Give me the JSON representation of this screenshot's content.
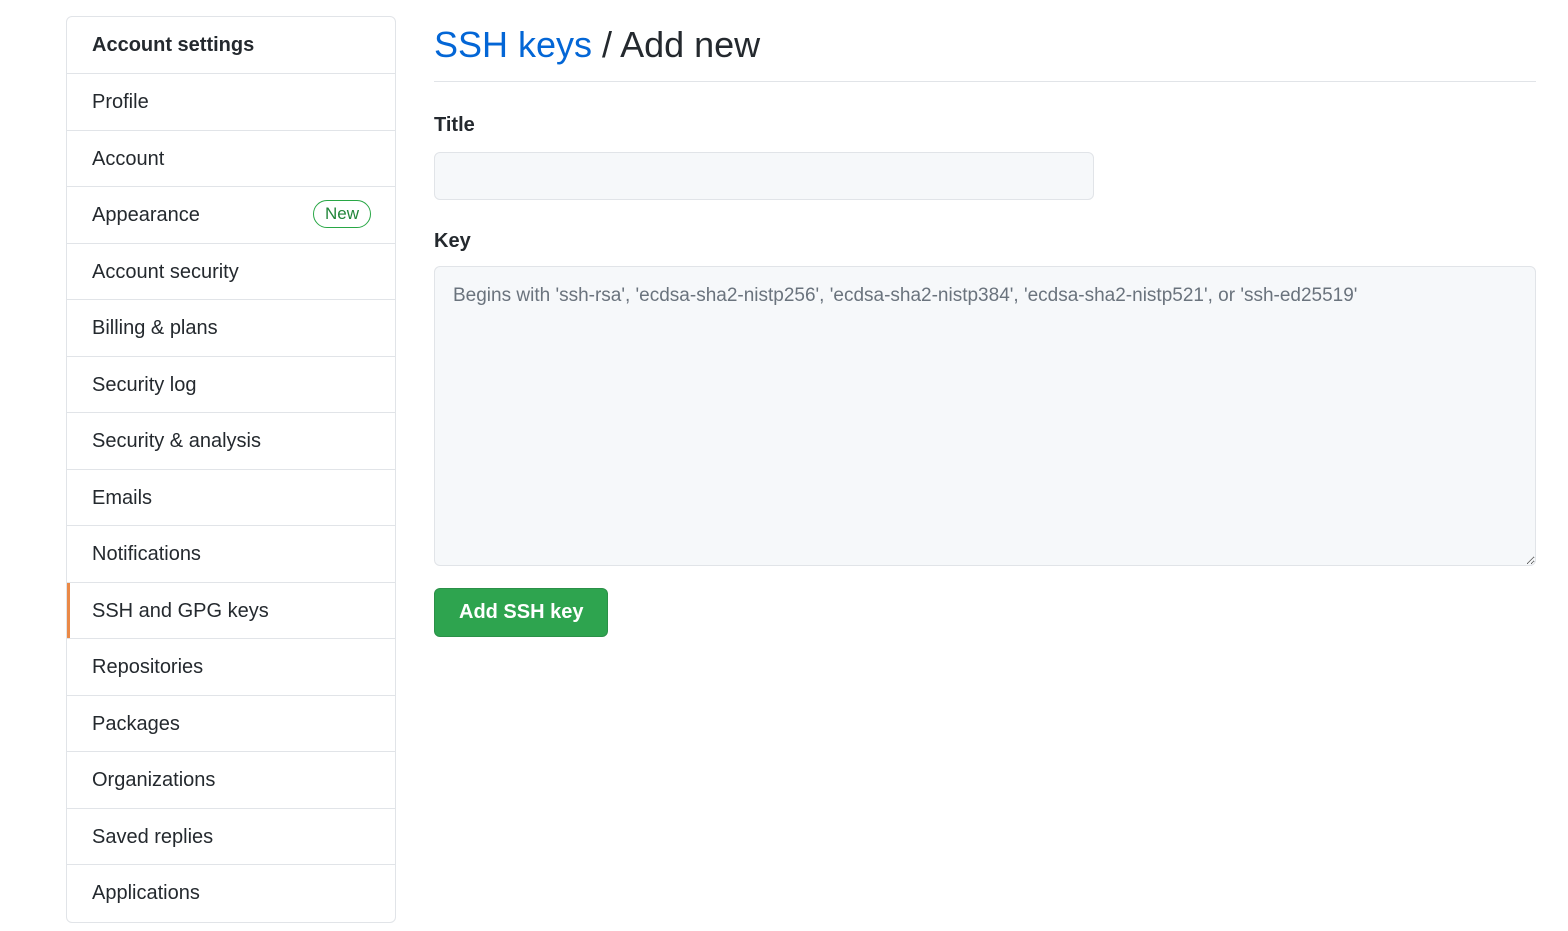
{
  "sidebar": {
    "header": "Account settings",
    "items": [
      {
        "label": "Profile"
      },
      {
        "label": "Account"
      },
      {
        "label": "Appearance",
        "badge": "New"
      },
      {
        "label": "Account security"
      },
      {
        "label": "Billing & plans"
      },
      {
        "label": "Security log"
      },
      {
        "label": "Security & analysis"
      },
      {
        "label": "Emails"
      },
      {
        "label": "Notifications"
      },
      {
        "label": "SSH and GPG keys",
        "selected": true
      },
      {
        "label": "Repositories"
      },
      {
        "label": "Packages"
      },
      {
        "label": "Organizations"
      },
      {
        "label": "Saved replies"
      },
      {
        "label": "Applications"
      }
    ]
  },
  "main": {
    "breadcrumb_link": "SSH keys",
    "breadcrumb_rest": " / Add new",
    "title_label": "Title",
    "title_value": "",
    "key_label": "Key",
    "key_placeholder": "Begins with 'ssh-rsa', 'ecdsa-sha2-nistp256', 'ecdsa-sha2-nistp384', 'ecdsa-sha2-nistp521', or 'ssh-ed25519'",
    "submit_label": "Add SSH key"
  },
  "colors": {
    "link": "#0366d6",
    "primary_button": "#2ea44f",
    "badge": "#28a745",
    "selected_indicator": "#e36209"
  }
}
